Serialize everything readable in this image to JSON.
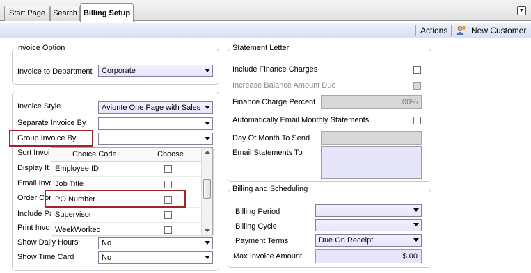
{
  "tabs": [
    {
      "label": "Start Page"
    },
    {
      "label": "Search"
    },
    {
      "label": "Billing Setup"
    }
  ],
  "toolbar": {
    "actions_label": "Actions",
    "new_customer_label": "New Customer"
  },
  "invoice_option": {
    "title": "Invoice Option",
    "invoice_to_department": {
      "label": "Invoice to Department",
      "value": "Corporate"
    }
  },
  "invoice_style_section": {
    "invoice_style": {
      "label": "Invoice Style",
      "value": "Avionte One Page with Sales"
    },
    "separate_invoice_by": {
      "label": "Separate Invoice By",
      "value": ""
    },
    "group_invoice_by": {
      "label": "Group Invoice By",
      "value": ""
    },
    "hidden_labels": [
      "Sort Invoi",
      "Display It",
      "Email Invo",
      "Order Cor",
      "Include Pa",
      "Print Invo"
    ],
    "show_daily_hours": {
      "label": "Show Daily Hours",
      "value": "No"
    },
    "show_time_card": {
      "label": "Show Time Card",
      "value": "No"
    }
  },
  "popup": {
    "columns": [
      "Choice Code",
      "Choose"
    ],
    "rows": [
      {
        "code": "Employee ID",
        "checked": false
      },
      {
        "code": "Job Title",
        "checked": false
      },
      {
        "code": "PO Number",
        "checked": false
      },
      {
        "code": "Supervisor",
        "checked": false
      },
      {
        "code": "WeekWorked",
        "checked": false
      }
    ]
  },
  "statement_letter": {
    "title": "Statement Letter",
    "include_finance_charges": "Include Finance Charges",
    "increase_balance_amount_due": "Increase Balance Amount Due",
    "finance_charge_percent": {
      "label": "Finance Charge Percent",
      "value": ".00%"
    },
    "auto_email_monthly_statements": "Automatically Email Monthly Statements",
    "day_of_month_to_send": "Day Of Month To Send",
    "email_statements_to": "Email Statements To"
  },
  "billing_scheduling": {
    "title": "Billing and Scheduling",
    "billing_period": {
      "label": "Billing Period",
      "value": ""
    },
    "billing_cycle": {
      "label": "Billing Cycle",
      "value": ""
    },
    "payment_terms": {
      "label": "Payment Terms",
      "value": "Due On Receipt"
    },
    "max_invoice_amount": {
      "label": "Max Invoice Amount",
      "value": "$.00"
    }
  },
  "colors": {
    "highlight": "#a0252a",
    "field_bg": "#e7e5fa",
    "toolbar_bg": "#d8e0f2"
  }
}
